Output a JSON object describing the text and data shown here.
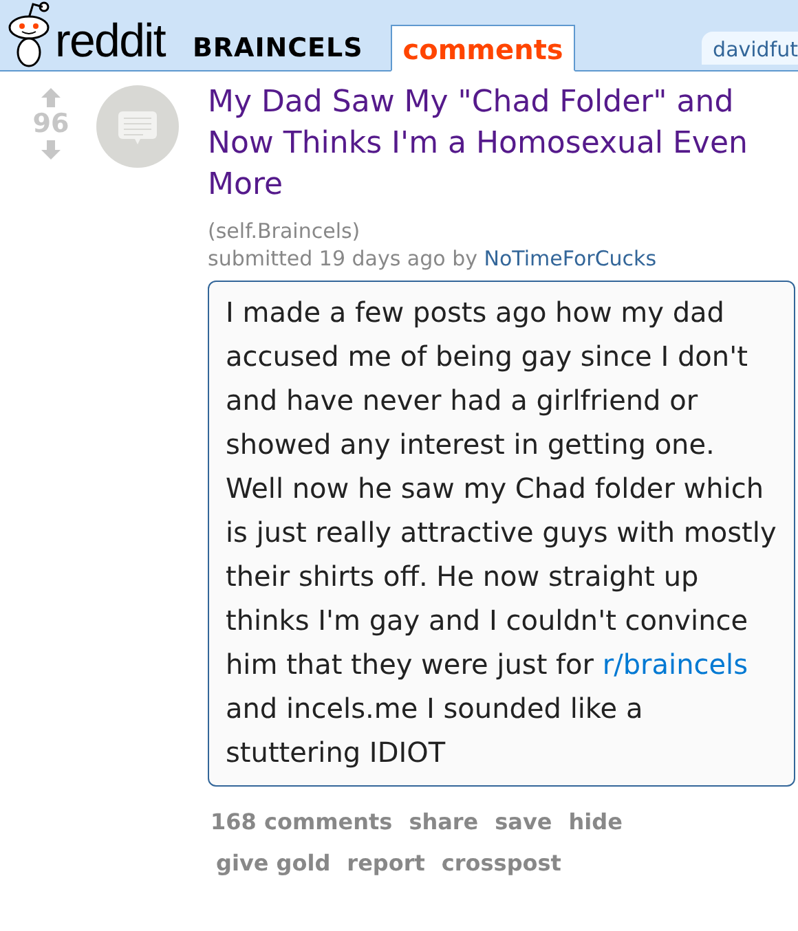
{
  "header": {
    "logo_text": "reddit",
    "subreddit": "BRAINCELS",
    "tabs": [
      {
        "label": "comments",
        "selected": true
      }
    ],
    "user": "davidfut"
  },
  "post": {
    "score": "96",
    "title": "My Dad Saw My \"Chad Folder\" and Now Thinks I'm a Homosexual Even More",
    "domain": "(self.Braincels)",
    "submitted": "submitted 19 days ago by",
    "author": "NoTimeForCucks",
    "body": [
      {
        "kind": "text",
        "text": "I made a few posts ago how my dad accused me of being gay since I don't and have never had a girlfriend or showed any interest in getting one. Well now he saw my Chad folder which is just really attractive guys with mostly their shirts off. He now straight up thinks I'm gay and I couldn't convince him that they were just for "
      },
      {
        "kind": "link",
        "text": "r/braincels"
      },
      {
        "kind": "text",
        "text": " and incels.me I sounded like a stuttering IDIOT"
      }
    ],
    "actions": [
      "168 comments",
      "share",
      "save",
      "hide",
      "give gold",
      "report",
      "crosspost"
    ]
  }
}
